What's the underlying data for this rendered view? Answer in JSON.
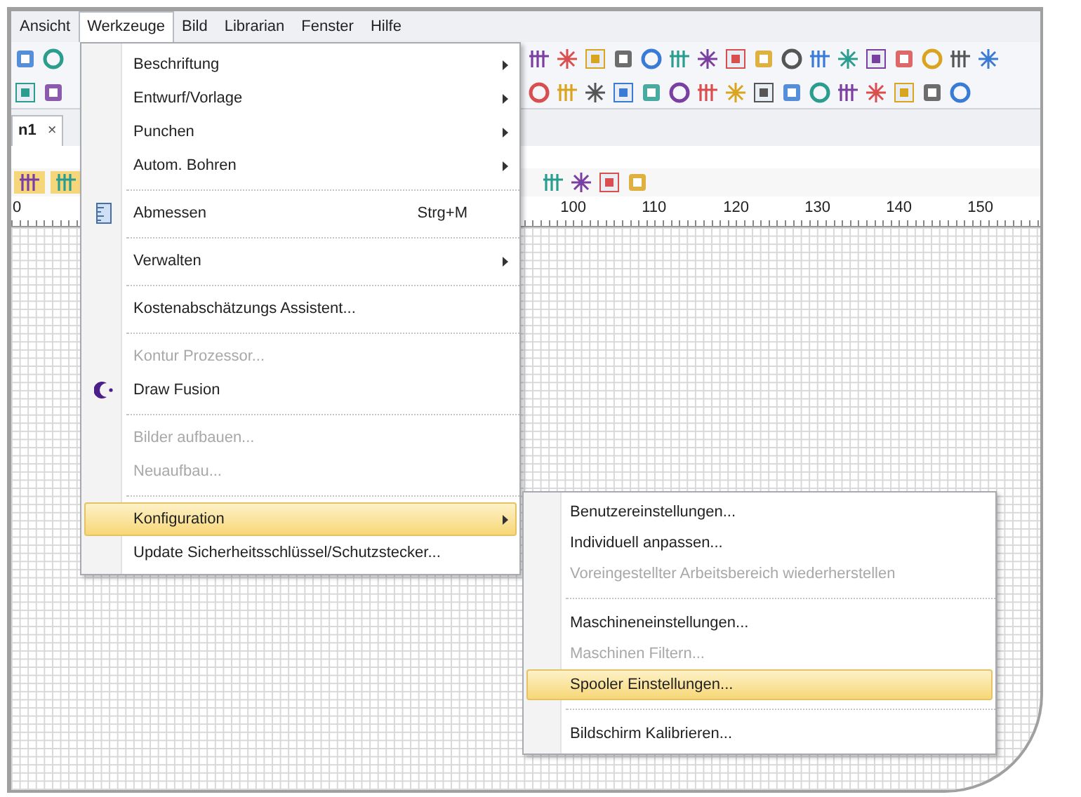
{
  "menubar": [
    {
      "label": "Ansicht",
      "selected": false
    },
    {
      "label": "Werkzeuge",
      "selected": true
    },
    {
      "label": "Bild",
      "selected": false
    },
    {
      "label": "Librarian",
      "selected": false
    },
    {
      "label": "Fenster",
      "selected": false
    },
    {
      "label": "Hilfe",
      "selected": false
    }
  ],
  "document_tab": {
    "label": "n1",
    "close": "×"
  },
  "ruler": {
    "start_label": "0",
    "labels": [
      "100",
      "110",
      "120",
      "130",
      "140",
      "150"
    ]
  },
  "menu": {
    "items": [
      {
        "kind": "item",
        "label": "Beschriftung",
        "submenu": true,
        "disabled": false,
        "selected": false
      },
      {
        "kind": "item",
        "label": "Entwurf/Vorlage",
        "submenu": true,
        "disabled": false,
        "selected": false
      },
      {
        "kind": "item",
        "label": "Punchen",
        "submenu": true,
        "disabled": false,
        "selected": false
      },
      {
        "kind": "item",
        "label": "Autom. Bohren",
        "submenu": true,
        "disabled": false,
        "selected": false
      },
      {
        "kind": "separator"
      },
      {
        "kind": "item",
        "label": "Abmessen",
        "shortcut": "Strg+M",
        "submenu": false,
        "disabled": false,
        "selected": false
      },
      {
        "kind": "separator"
      },
      {
        "kind": "item",
        "label": "Verwalten",
        "submenu": true,
        "disabled": false,
        "selected": false
      },
      {
        "kind": "separator"
      },
      {
        "kind": "item",
        "label": "Kostenabschätzungs Assistent...",
        "submenu": false,
        "disabled": false,
        "selected": false
      },
      {
        "kind": "separator"
      },
      {
        "kind": "item",
        "label": "Kontur Prozessor...",
        "submenu": false,
        "disabled": true,
        "selected": false
      },
      {
        "kind": "item",
        "label": "Draw Fusion",
        "submenu": false,
        "disabled": false,
        "selected": false
      },
      {
        "kind": "separator"
      },
      {
        "kind": "item",
        "label": "Bilder aufbauen...",
        "submenu": false,
        "disabled": true,
        "selected": false
      },
      {
        "kind": "item",
        "label": "Neuaufbau...",
        "submenu": false,
        "disabled": true,
        "selected": false
      },
      {
        "kind": "separator"
      },
      {
        "kind": "item",
        "label": "Konfiguration",
        "submenu": true,
        "disabled": false,
        "selected": true
      },
      {
        "kind": "item",
        "label": "Update Sicherheitsschlüssel/Schutzstecker...",
        "submenu": false,
        "disabled": false,
        "selected": false
      }
    ]
  },
  "submenu": {
    "items": [
      {
        "kind": "item",
        "label": "Benutzereinstellungen...",
        "disabled": false,
        "selected": false
      },
      {
        "kind": "item",
        "label": "Individuell anpassen...",
        "disabled": false,
        "selected": false
      },
      {
        "kind": "item",
        "label": "Voreingestellter Arbeitsbereich wiederherstellen",
        "disabled": true,
        "selected": false
      },
      {
        "kind": "separator"
      },
      {
        "kind": "item",
        "label": "Maschineneinstellungen...",
        "disabled": false,
        "selected": false
      },
      {
        "kind": "item",
        "label": "Maschinen Filtern...",
        "disabled": true,
        "selected": false
      },
      {
        "kind": "item",
        "label": "Spooler Einstellungen...",
        "disabled": false,
        "selected": true
      },
      {
        "kind": "separator"
      },
      {
        "kind": "item",
        "label": "Bildschirm Kalibrieren...",
        "disabled": false,
        "selected": false
      }
    ]
  }
}
